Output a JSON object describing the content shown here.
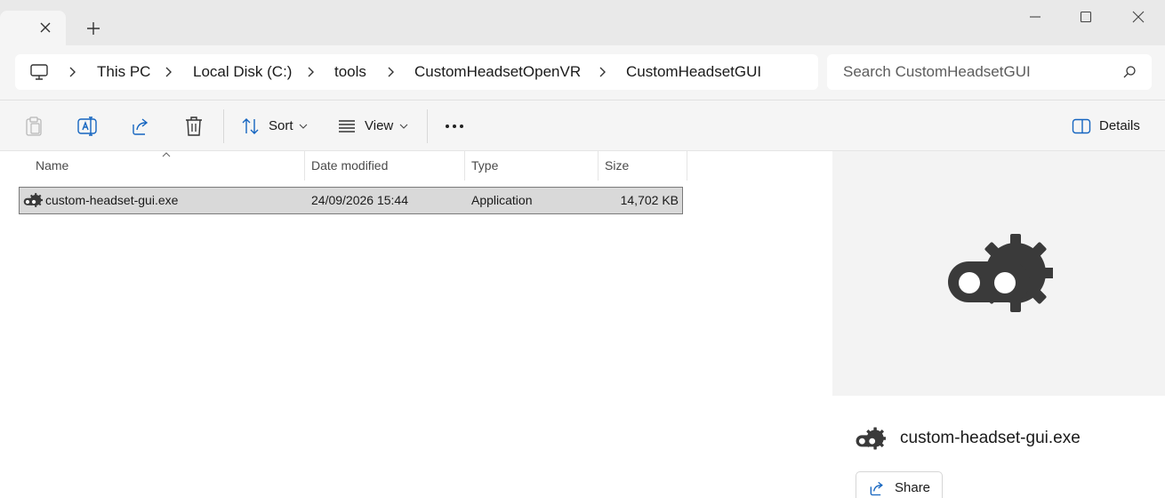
{
  "window": {
    "new_tab_label": "+"
  },
  "breadcrumb": {
    "items": [
      "This PC",
      "Local Disk (C:)",
      "tools",
      "CustomHeadsetOpenVR",
      "CustomHeadsetGUI"
    ]
  },
  "search": {
    "placeholder": "Search CustomHeadsetGUI"
  },
  "toolbar": {
    "sort_label": "Sort",
    "view_label": "View",
    "details_label": "Details"
  },
  "file_list": {
    "columns": [
      "Name",
      "Date modified",
      "Type",
      "Size"
    ],
    "rows": [
      {
        "name": "custom-headset-gui.exe",
        "date_modified": "24/09/2026 15:44",
        "type": "Application",
        "size": "14,702 KB",
        "icon": "headset-gear-icon"
      }
    ]
  },
  "details_pane": {
    "file_name": "custom-headset-gui.exe",
    "share_label": "Share",
    "icon": "headset-gear-icon"
  },
  "colors": {
    "tabstrip_bg": "#e9e9e9",
    "toolbar_bg": "#f5f5f5",
    "selection_bg": "#d9d9d9",
    "accent_blue": "#1565c0",
    "icon_dark": "#3a3a3a"
  }
}
